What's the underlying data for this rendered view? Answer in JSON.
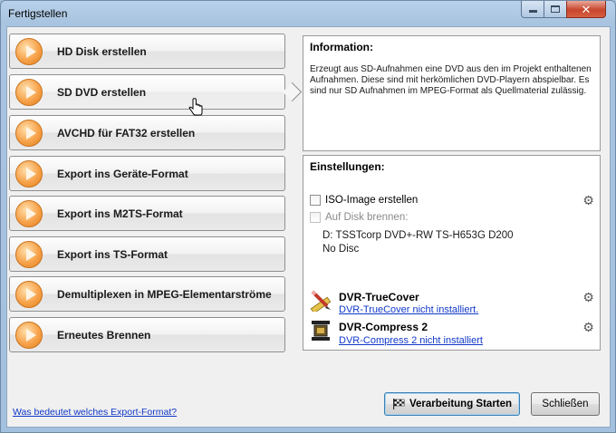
{
  "window": {
    "title": "Fertigstellen",
    "close_glyph": "✕"
  },
  "menu": {
    "items": [
      {
        "label": "HD Disk erstellen"
      },
      {
        "label": "SD DVD erstellen"
      },
      {
        "label": "AVCHD für FAT32 erstellen"
      },
      {
        "label": "Export ins Geräte-Format"
      },
      {
        "label": "Export ins M2TS-Format"
      },
      {
        "label": "Export ins TS-Format"
      },
      {
        "label": "Demultiplexen in MPEG-Elementarströme"
      },
      {
        "label": "Erneutes Brennen"
      }
    ],
    "selected_index": 1
  },
  "information": {
    "title": "Information:",
    "text": "Erzeugt aus SD-Aufnahmen eine DVD aus den im Projekt enthaltenen Aufnahmen. Diese sind mit herkömlichen DVD-Playern abspielbar. Es sind nur SD Aufnahmen im MPEG-Format als Quellmaterial zulässig."
  },
  "settings": {
    "title": "Einstellungen:",
    "iso_label": "ISO-Image erstellen",
    "burn_label": "Auf Disk brennen:",
    "drive_name": "D: TSSTcorp DVD+-RW TS-H653G D200",
    "drive_status": "No Disc",
    "addons": [
      {
        "title": "DVR-TrueCover",
        "link": "DVR-TrueCover nicht installiert.",
        "icon": "pencil-ruler-icon"
      },
      {
        "title": "DVR-Compress 2",
        "link": "DVR-Compress 2 nicht installiert",
        "icon": "compress-vise-icon"
      }
    ],
    "gear_glyph": "⚙"
  },
  "footer": {
    "help_link": "Was bedeutet welches Export-Format?",
    "start_label": "Verarbeitung Starten",
    "close_label": "Schließen"
  }
}
